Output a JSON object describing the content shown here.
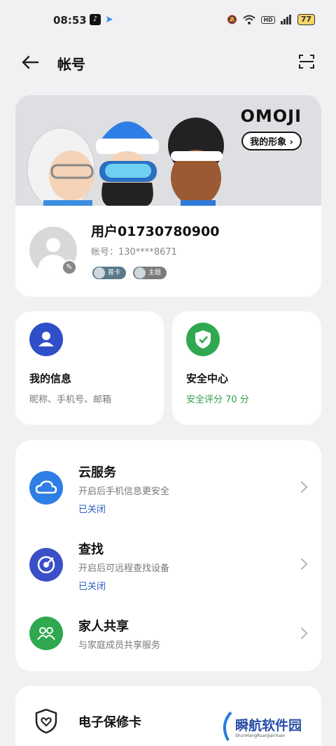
{
  "status_bar": {
    "time": "08:53",
    "battery": "77",
    "hd": "HD"
  },
  "header": {
    "title": "帐号"
  },
  "profile": {
    "brand": "OMOJI",
    "brand_button": "我的形象 ›",
    "username": "用户01730780900",
    "account_label": "帐号：130****8671",
    "badge_1": "普卡",
    "badge_2": "主题"
  },
  "my_info": {
    "title": "我的信息",
    "subtitle": "昵称、手机号、邮箱"
  },
  "security": {
    "title": "安全中心",
    "subtitle": "安全评分 70 分"
  },
  "services": [
    {
      "title": "云服务",
      "subtitle": "开启后手机信息更安全",
      "status": "已关闭"
    },
    {
      "title": "查找",
      "subtitle": "开启后可远程查找设备",
      "status": "已关闭"
    },
    {
      "title": "家人共享",
      "subtitle": "与家庭成员共享服务"
    }
  ],
  "bottom_item": {
    "title": "电子保修卡"
  },
  "watermark": {
    "text": "瞬航软件园",
    "sub": "ShunHangRuanJianYuan"
  },
  "colors": {
    "blue": "#2f66e0",
    "green": "#2fa84f",
    "navy": "#3b4fc8"
  }
}
